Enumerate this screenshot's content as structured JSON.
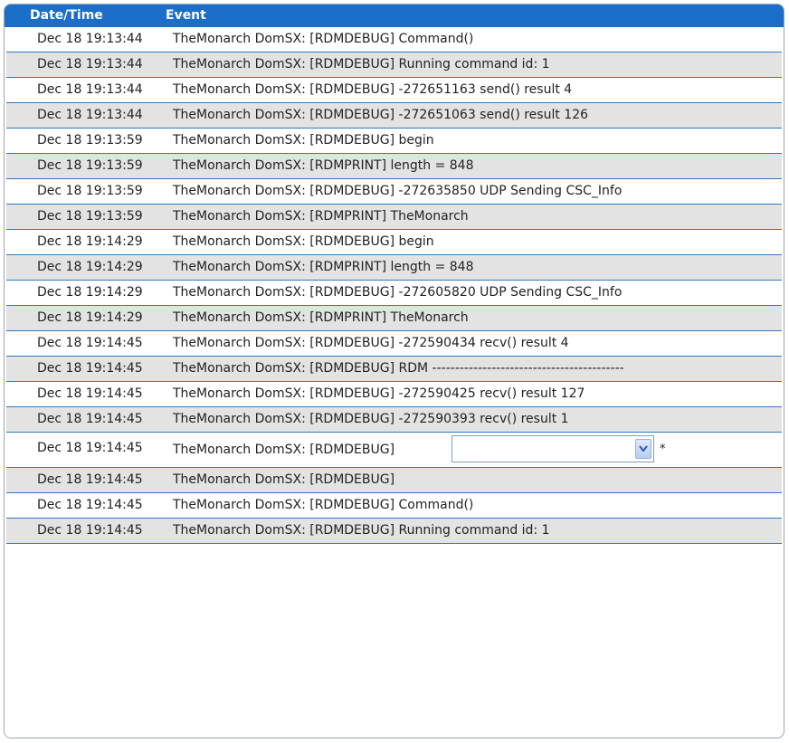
{
  "header": {
    "date_time": "Date/Time",
    "event": "Event"
  },
  "rows": [
    {
      "dt": "Dec 18 19:13:44",
      "ev": "TheMonarch DomSX: [RDMDEBUG] Command()"
    },
    {
      "dt": "Dec 18 19:13:44",
      "ev": "TheMonarch DomSX: [RDMDEBUG] Running command id: 1"
    },
    {
      "dt": "Dec 18 19:13:44",
      "ev": "TheMonarch DomSX: [RDMDEBUG] -272651163 send() result 4"
    },
    {
      "dt": "Dec 18 19:13:44",
      "ev": "TheMonarch DomSX: [RDMDEBUG] -272651063 send() result 126"
    },
    {
      "dt": "Dec 18 19:13:59",
      "ev": "TheMonarch DomSX: [RDMDEBUG] begin"
    },
    {
      "dt": "Dec 18 19:13:59",
      "ev": "TheMonarch DomSX: [RDMPRINT] length = 848"
    },
    {
      "dt": "Dec 18 19:13:59",
      "ev": "TheMonarch DomSX: [RDMDEBUG] -272635850 UDP Sending CSC_Info"
    },
    {
      "dt": "Dec 18 19:13:59",
      "ev": "TheMonarch DomSX: [RDMPRINT] TheMonarch"
    },
    {
      "dt": "Dec 18 19:14:29",
      "ev": "TheMonarch DomSX: [RDMDEBUG] begin"
    },
    {
      "dt": "Dec 18 19:14:29",
      "ev": "TheMonarch DomSX: [RDMPRINT] length = 848"
    },
    {
      "dt": "Dec 18 19:14:29",
      "ev": "TheMonarch DomSX: [RDMDEBUG] -272605820 UDP Sending CSC_Info"
    },
    {
      "dt": "Dec 18 19:14:29",
      "ev": "TheMonarch DomSX: [RDMPRINT] TheMonarch"
    },
    {
      "dt": "Dec 18 19:14:45",
      "ev": "TheMonarch DomSX: [RDMDEBUG] -272590434 recv() result 4"
    },
    {
      "dt": "Dec 18 19:14:45",
      "ev": "TheMonarch DomSX: [RDMDEBUG] RDM ------------------------------------------"
    },
    {
      "dt": "Dec 18 19:14:45",
      "ev": "TheMonarch DomSX: [RDMDEBUG] -272590425 recv() result 127"
    },
    {
      "dt": "Dec 18 19:14:45",
      "ev": "TheMonarch DomSX: [RDMDEBUG] -272590393 recv() result 1"
    }
  ],
  "select_row": {
    "dt": "Dec 18 19:14:45",
    "ev": "TheMonarch DomSX: [RDMDEBUG]",
    "select_value": "",
    "asterisk": "*"
  },
  "rows_after": [
    {
      "dt": "Dec 18 19:14:45",
      "ev": "TheMonarch DomSX: [RDMDEBUG]"
    },
    {
      "dt": "Dec 18 19:14:45",
      "ev": "TheMonarch DomSX: [RDMDEBUG] Command()"
    },
    {
      "dt": "Dec 18 19:14:45",
      "ev": "TheMonarch DomSX: [RDMDEBUG] Running command id: 1"
    }
  ],
  "colors": {
    "header_bg": "#1b6fc9",
    "row_alt_bg": "#e3e3e3",
    "row_border": "#2f78c6"
  },
  "icons": {
    "select_button": "chevron-down-icon"
  }
}
